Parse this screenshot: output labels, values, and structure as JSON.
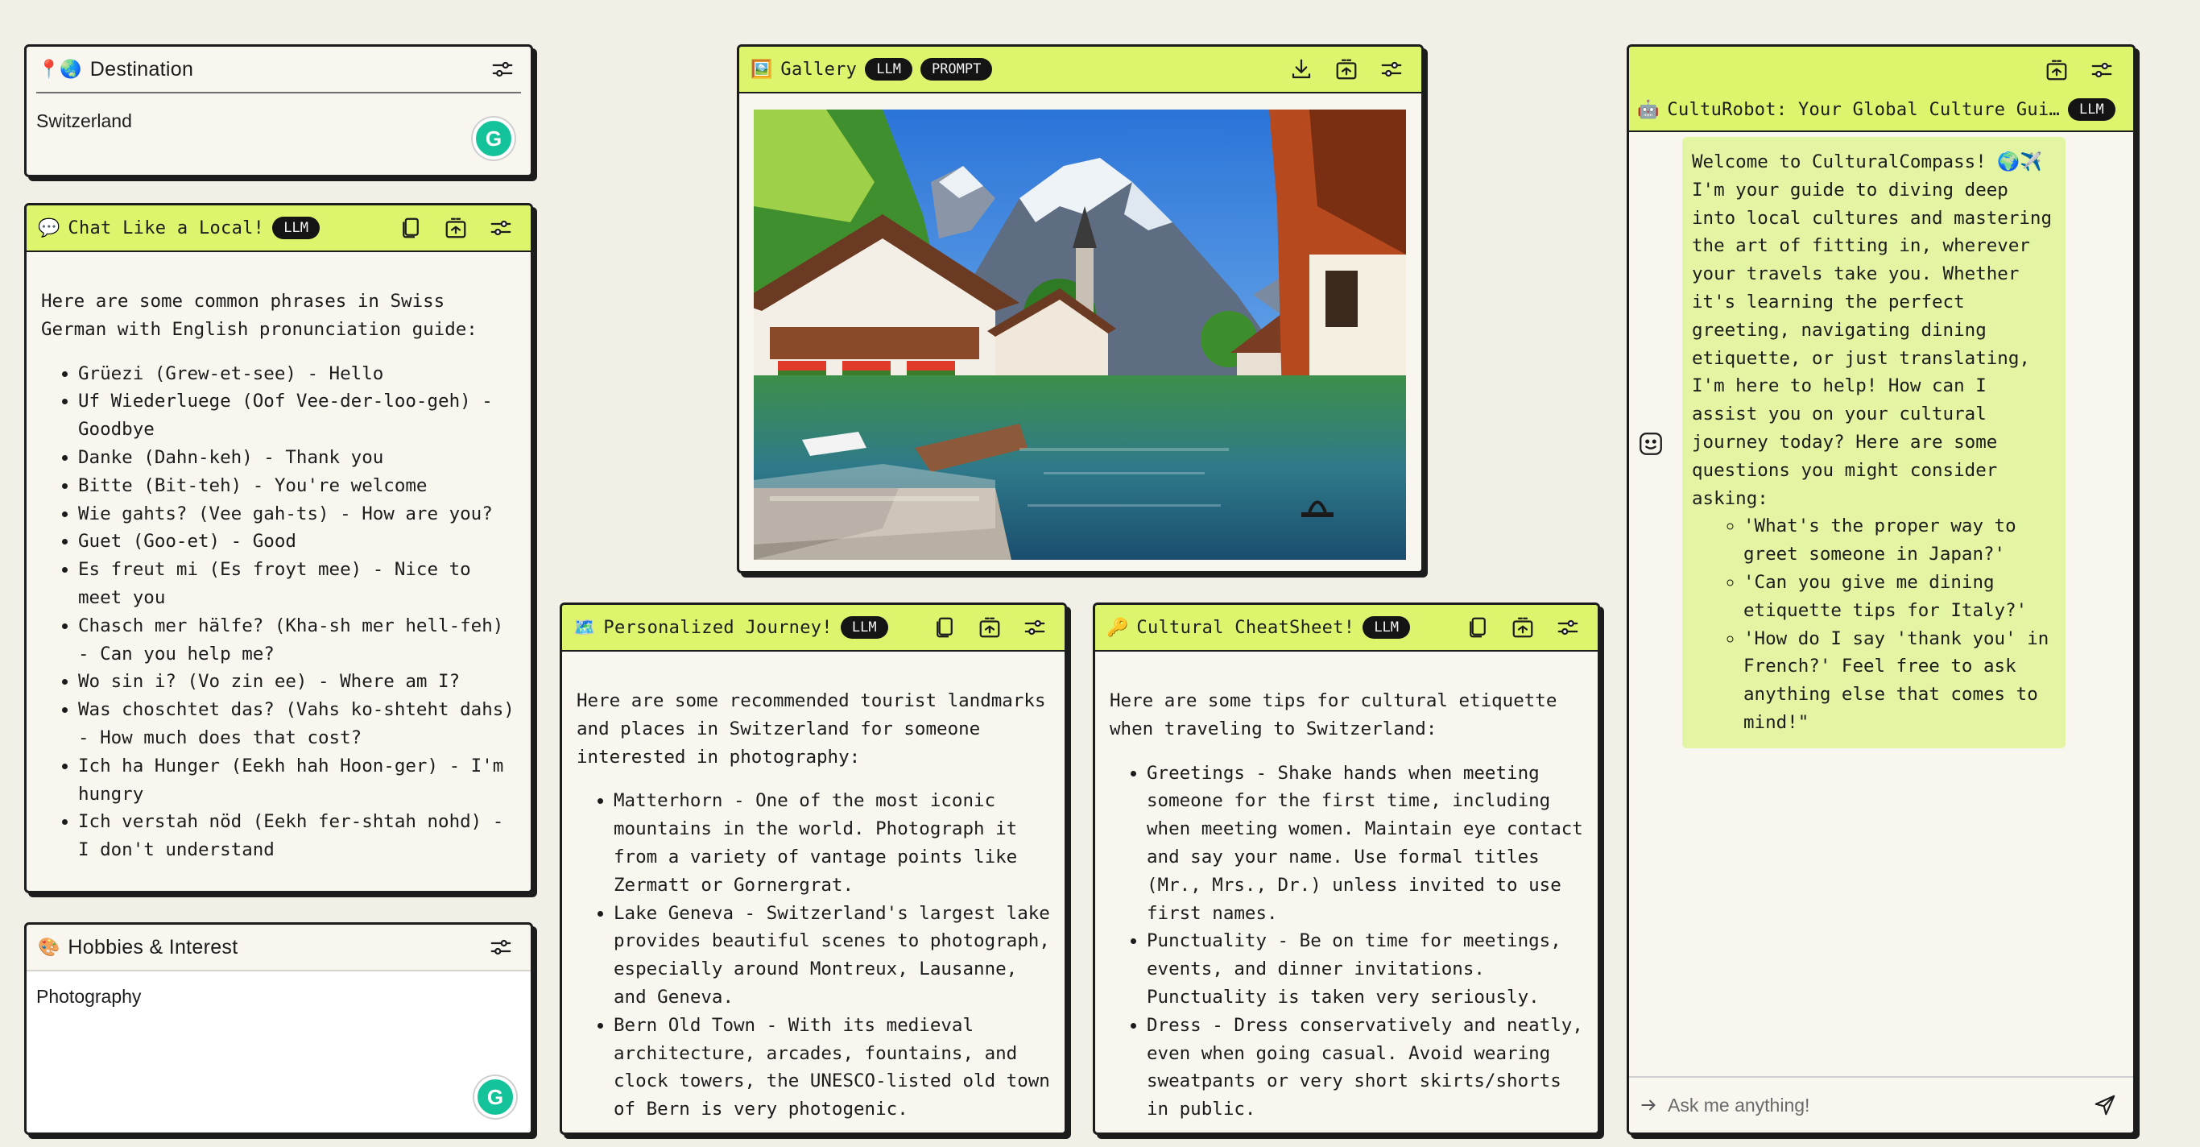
{
  "destination": {
    "emoji": "📍🌏",
    "title": "Destination",
    "value": "Switzerland",
    "grammarly": "G"
  },
  "chat_local": {
    "emoji": "💬",
    "title": "Chat Like a Local!",
    "badge": "LLM",
    "intro": "Here are some common phrases in Swiss German with English pronunciation guide:",
    "items": [
      "Grüezi (Grew-et-see) - Hello",
      "Uf Wiederluege (Oof Vee-der-loo-geh) - Goodbye",
      "Danke (Dahn-keh) - Thank you",
      "Bitte (Bit-teh) - You're welcome",
      "Wie gahts? (Vee gah-ts) - How are you?",
      "Guet (Goo-et) - Good",
      "Es freut mi (Es froyt mee) - Nice to meet you",
      "Chasch mer hälfe? (Kha-sh mer hell-feh) - Can you help me?",
      "Wo sin i? (Vo zin ee) - Where am I?",
      "Was choschtet das? (Vahs ko-shteht dahs) - How much does that cost?",
      "Ich ha Hunger (Eekh hah Hoon-ger) - I'm hungry",
      "Ich verstah nöd (Eekh fer-shtah nohd) - I don't understand"
    ]
  },
  "hobbies": {
    "emoji": "🎨",
    "title": "Hobbies & Interest",
    "value": "Photography",
    "grammarly": "G"
  },
  "gallery": {
    "emoji": "🖼️",
    "title": "Gallery",
    "badges": [
      "LLM",
      "PROMPT"
    ]
  },
  "journey": {
    "emoji": "🗺️",
    "title": "Personalized Journey!",
    "badge": "LLM",
    "intro": "Here are some recommended tourist landmarks and places in Switzerland for someone interested in photography:",
    "items": [
      "Matterhorn - One of the most iconic mountains in the world. Photograph it from a variety of vantage points like Zermatt or Gornergrat.",
      "Lake Geneva - Switzerland's largest lake provides beautiful scenes to photograph, especially around Montreux, Lausanne, and Geneva.",
      "Bern Old Town - With its medieval architecture, arcades, fountains, and clock towers, the UNESCO-listed old town of Bern is very photogenic."
    ]
  },
  "cheatsheet": {
    "emoji": "🔑",
    "title": "Cultural CheatSheet!",
    "badge": "LLM",
    "intro": "Here are some tips for cultural etiquette when traveling to Switzerland:",
    "items": [
      "Greetings - Shake hands when meeting someone for the first time, including when meeting women. Maintain eye contact and say your name. Use formal titles (Mr., Mrs., Dr.) unless invited to use first names.",
      "Punctuality - Be on time for meetings, events, and dinner invitations. Punctuality is taken very seriously.",
      "Dress - Dress conservatively and neatly, even when going casual. Avoid wearing sweatpants or very short skirts/shorts in public."
    ]
  },
  "culturobot": {
    "emoji": "🤖",
    "title": "CultuRobot: Your Global Culture Gui…",
    "badge": "LLM",
    "message": "Welcome to CulturalCompass! 🌍✈️ I'm your guide to diving deep into local cultures and mastering the art of fitting in, wherever your travels take you. Whether it's learning the perfect greeting, navigating dining etiquette, or just translating, I'm here to help! How can I assist you on your cultural journey today? Here are some questions you might consider asking:",
    "suggestions": [
      "'What's the proper way to greet someone in Japan?'",
      "'Can you give me dining etiquette tips for Italy?'",
      "'How do I say 'thank you' in French?' Feel free to ask anything else that comes to mind!\""
    ],
    "input_placeholder": "Ask me anything!"
  }
}
